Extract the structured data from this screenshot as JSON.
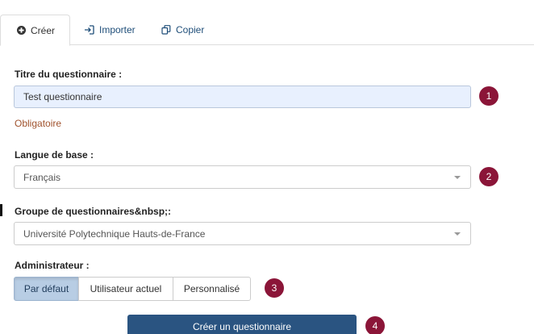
{
  "tabs": [
    {
      "label": "Créer",
      "icon": "plus-circle-icon",
      "active": true
    },
    {
      "label": "Importer",
      "icon": "import-icon",
      "active": false
    },
    {
      "label": "Copier",
      "icon": "copy-icon",
      "active": false
    }
  ],
  "form": {
    "title_label": "Titre du questionnaire :",
    "title_value": "Test questionnaire",
    "title_hint": "Obligatoire",
    "language_label": "Langue de base :",
    "language_value": "Français",
    "group_label": "Groupe de questionnaires&nbsp;:",
    "group_value": "Université Polytechnique Hauts-de-France",
    "admin_label": "Administrateur :",
    "admin_options": [
      "Par défaut",
      "Utilisateur actuel",
      "Personnalisé"
    ],
    "admin_selected": "Par défaut",
    "submit_label": "Créer un questionnaire"
  },
  "badges": [
    "1",
    "2",
    "3",
    "4"
  ],
  "colors": {
    "badge": "#8b1538",
    "primary": "#2a5481",
    "hint": "#a0522d",
    "active_segment": "#b8cde4",
    "input_highlight": "#e8f0fe"
  }
}
